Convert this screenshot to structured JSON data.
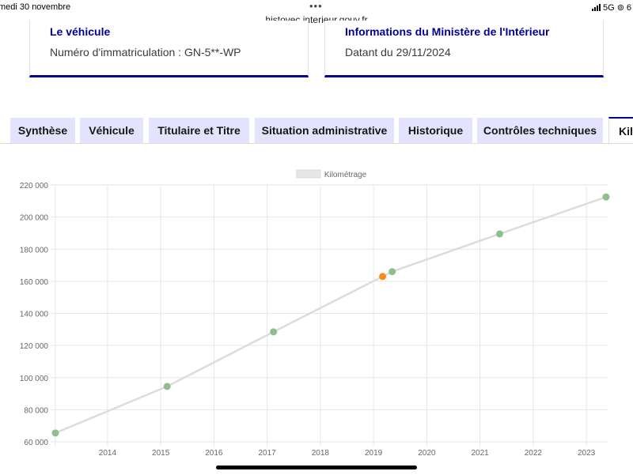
{
  "status_bar": {
    "date": "medi 30 novembre",
    "url": "histovec.interieur.gouv.fr",
    "network": "5G",
    "battery_partial": "6"
  },
  "cards": {
    "vehicle": {
      "title": "Le véhicule",
      "plate_label": "Numéro d'immatriculation : GN-5**-WP"
    },
    "ministry": {
      "title": "Informations du Ministère de l'Intérieur",
      "date_label": "Datant du 29/11/2024"
    }
  },
  "tabs": [
    {
      "label": "Synthèse",
      "active": false
    },
    {
      "label": "Véhicule",
      "active": false
    },
    {
      "label": "Titulaire et Titre",
      "active": false
    },
    {
      "label": "Situation administrative",
      "active": false
    },
    {
      "label": "Historique",
      "active": false
    },
    {
      "label": "Contrôles techniques",
      "active": false
    },
    {
      "label": "Kilo",
      "active": true
    }
  ],
  "colors": {
    "accent": "#000091",
    "tab_bg": "#e3e3fd",
    "point_normal": "#8fbe8d",
    "point_highlight": "#f58a1f",
    "line": "#dcdcdc"
  },
  "chart_data": {
    "type": "line",
    "title": "",
    "legend": {
      "label": "Kilométrage",
      "position": "top"
    },
    "xlabel": "",
    "ylabel": "",
    "x_ticks": [
      "2014",
      "2015",
      "2016",
      "2017",
      "2018",
      "2019",
      "2020",
      "2021",
      "2022",
      "2023"
    ],
    "y_ticks": [
      "60 000",
      "80 000",
      "100 000",
      "120 000",
      "140 000",
      "160 000",
      "180 000",
      "200 000",
      "220 000"
    ],
    "xlim": [
      2013.02,
      2023.4
    ],
    "ylim": [
      60000,
      220000
    ],
    "grid": true,
    "series": [
      {
        "name": "Kilométrage",
        "points": [
          {
            "x": 2013.02,
            "y": 65500,
            "highlight": false
          },
          {
            "x": 2015.12,
            "y": 94500,
            "highlight": false
          },
          {
            "x": 2017.12,
            "y": 128500,
            "highlight": false
          },
          {
            "x": 2019.17,
            "y": 163000,
            "highlight": true
          },
          {
            "x": 2019.35,
            "y": 166000,
            "highlight": false
          },
          {
            "x": 2021.37,
            "y": 189500,
            "highlight": false
          },
          {
            "x": 2023.37,
            "y": 212500,
            "highlight": false
          }
        ]
      }
    ]
  }
}
